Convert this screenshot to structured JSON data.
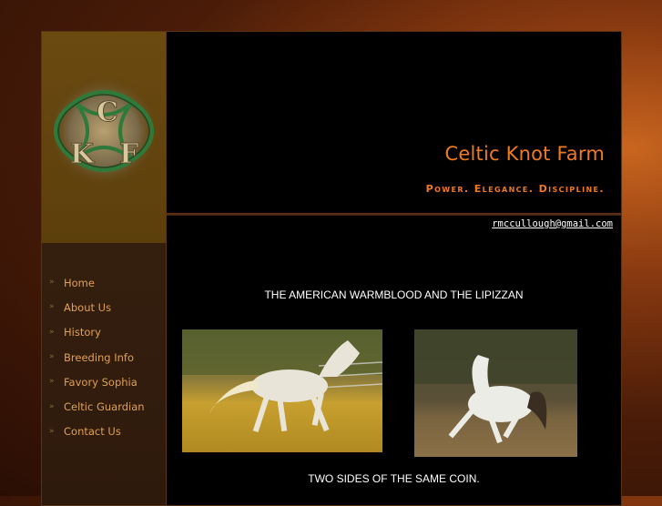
{
  "site": {
    "title": "Celtic Knot Farm",
    "tagline": "Power. Elegance. Discipline.",
    "email": "rmccullough@gmail.com"
  },
  "logo": {
    "letters": [
      "C",
      "K",
      "F"
    ]
  },
  "nav": {
    "items": [
      {
        "label": "Home"
      },
      {
        "label": "About Us"
      },
      {
        "label": "History"
      },
      {
        "label": "Breeding Info"
      },
      {
        "label": "Favory Sophia"
      },
      {
        "label": "Celtic Guardian"
      },
      {
        "label": "Contact Us"
      }
    ]
  },
  "main": {
    "heading": "THE AMERICAN WARMBLOOD AND THE LIPIZZAN",
    "caption": "TWO SIDES OF THE SAME COIN."
  },
  "colors": {
    "accent": "#f07a20",
    "nav_text": "#e0a050",
    "background": "#000000"
  }
}
